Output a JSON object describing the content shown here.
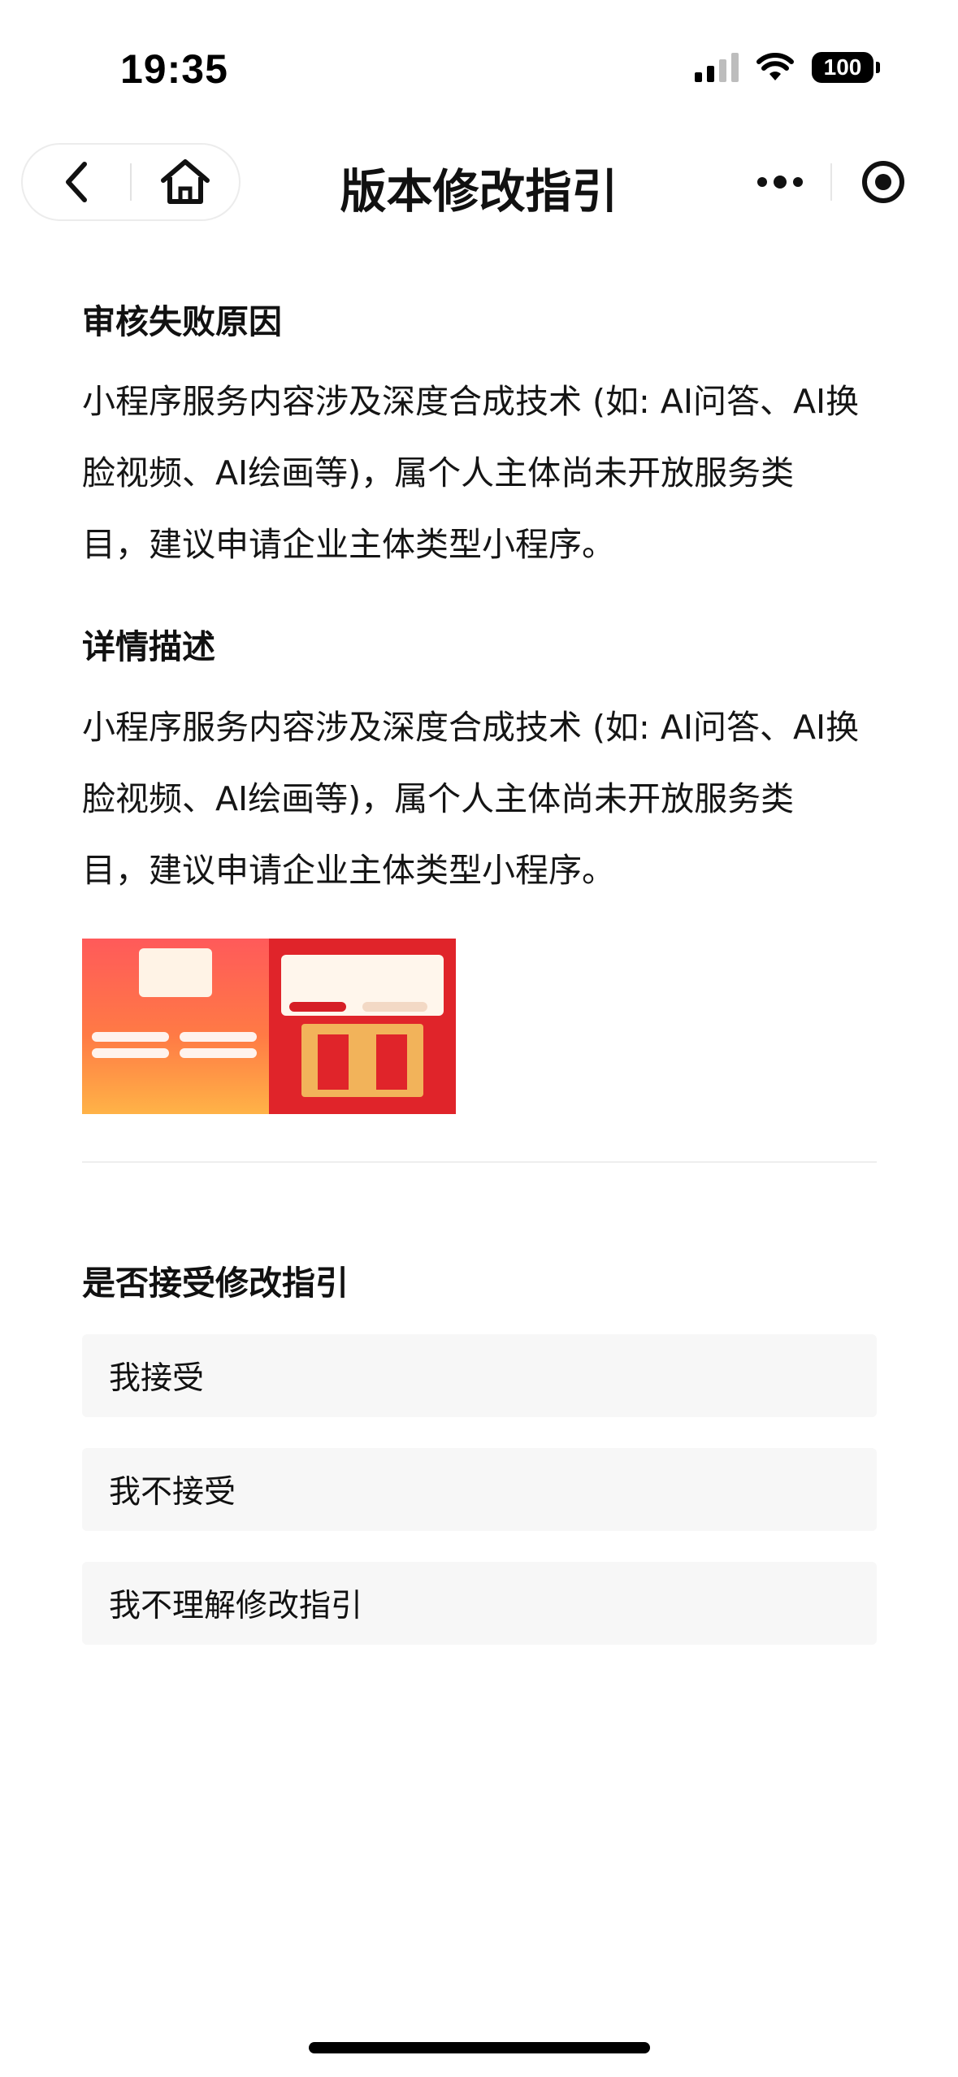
{
  "status_bar": {
    "time": "19:35",
    "battery": "100"
  },
  "nav": {
    "title": "版本修改指引",
    "back_icon": "chevron-left-icon",
    "home_icon": "home-icon",
    "more_icon": "more-dots-icon",
    "close_icon": "target-close-icon"
  },
  "reason": {
    "title": "审核失败原因",
    "lines": [
      "小程序服务内容涉及深度合成技术 (如: AI问答、AI换",
      "脸视频、AI绘画等)，属个人主体尚未开放服务类",
      "目，建议申请企业主体类型小程序。"
    ]
  },
  "details": {
    "title": "详情描述",
    "lines": [
      "小程序服务内容涉及深度合成技术 (如: AI问答、AI换",
      "脸视频、AI绘画等)，属个人主体尚未开放服务类",
      "目，建议申请企业主体类型小程序。"
    ]
  },
  "question": {
    "title": "是否接受修改指引",
    "options": [
      "我接受",
      "我不接受",
      "我不理解修改指引"
    ]
  },
  "colors": {
    "accent_red": "#e0242a",
    "option_bg": "#f7f7f7"
  }
}
